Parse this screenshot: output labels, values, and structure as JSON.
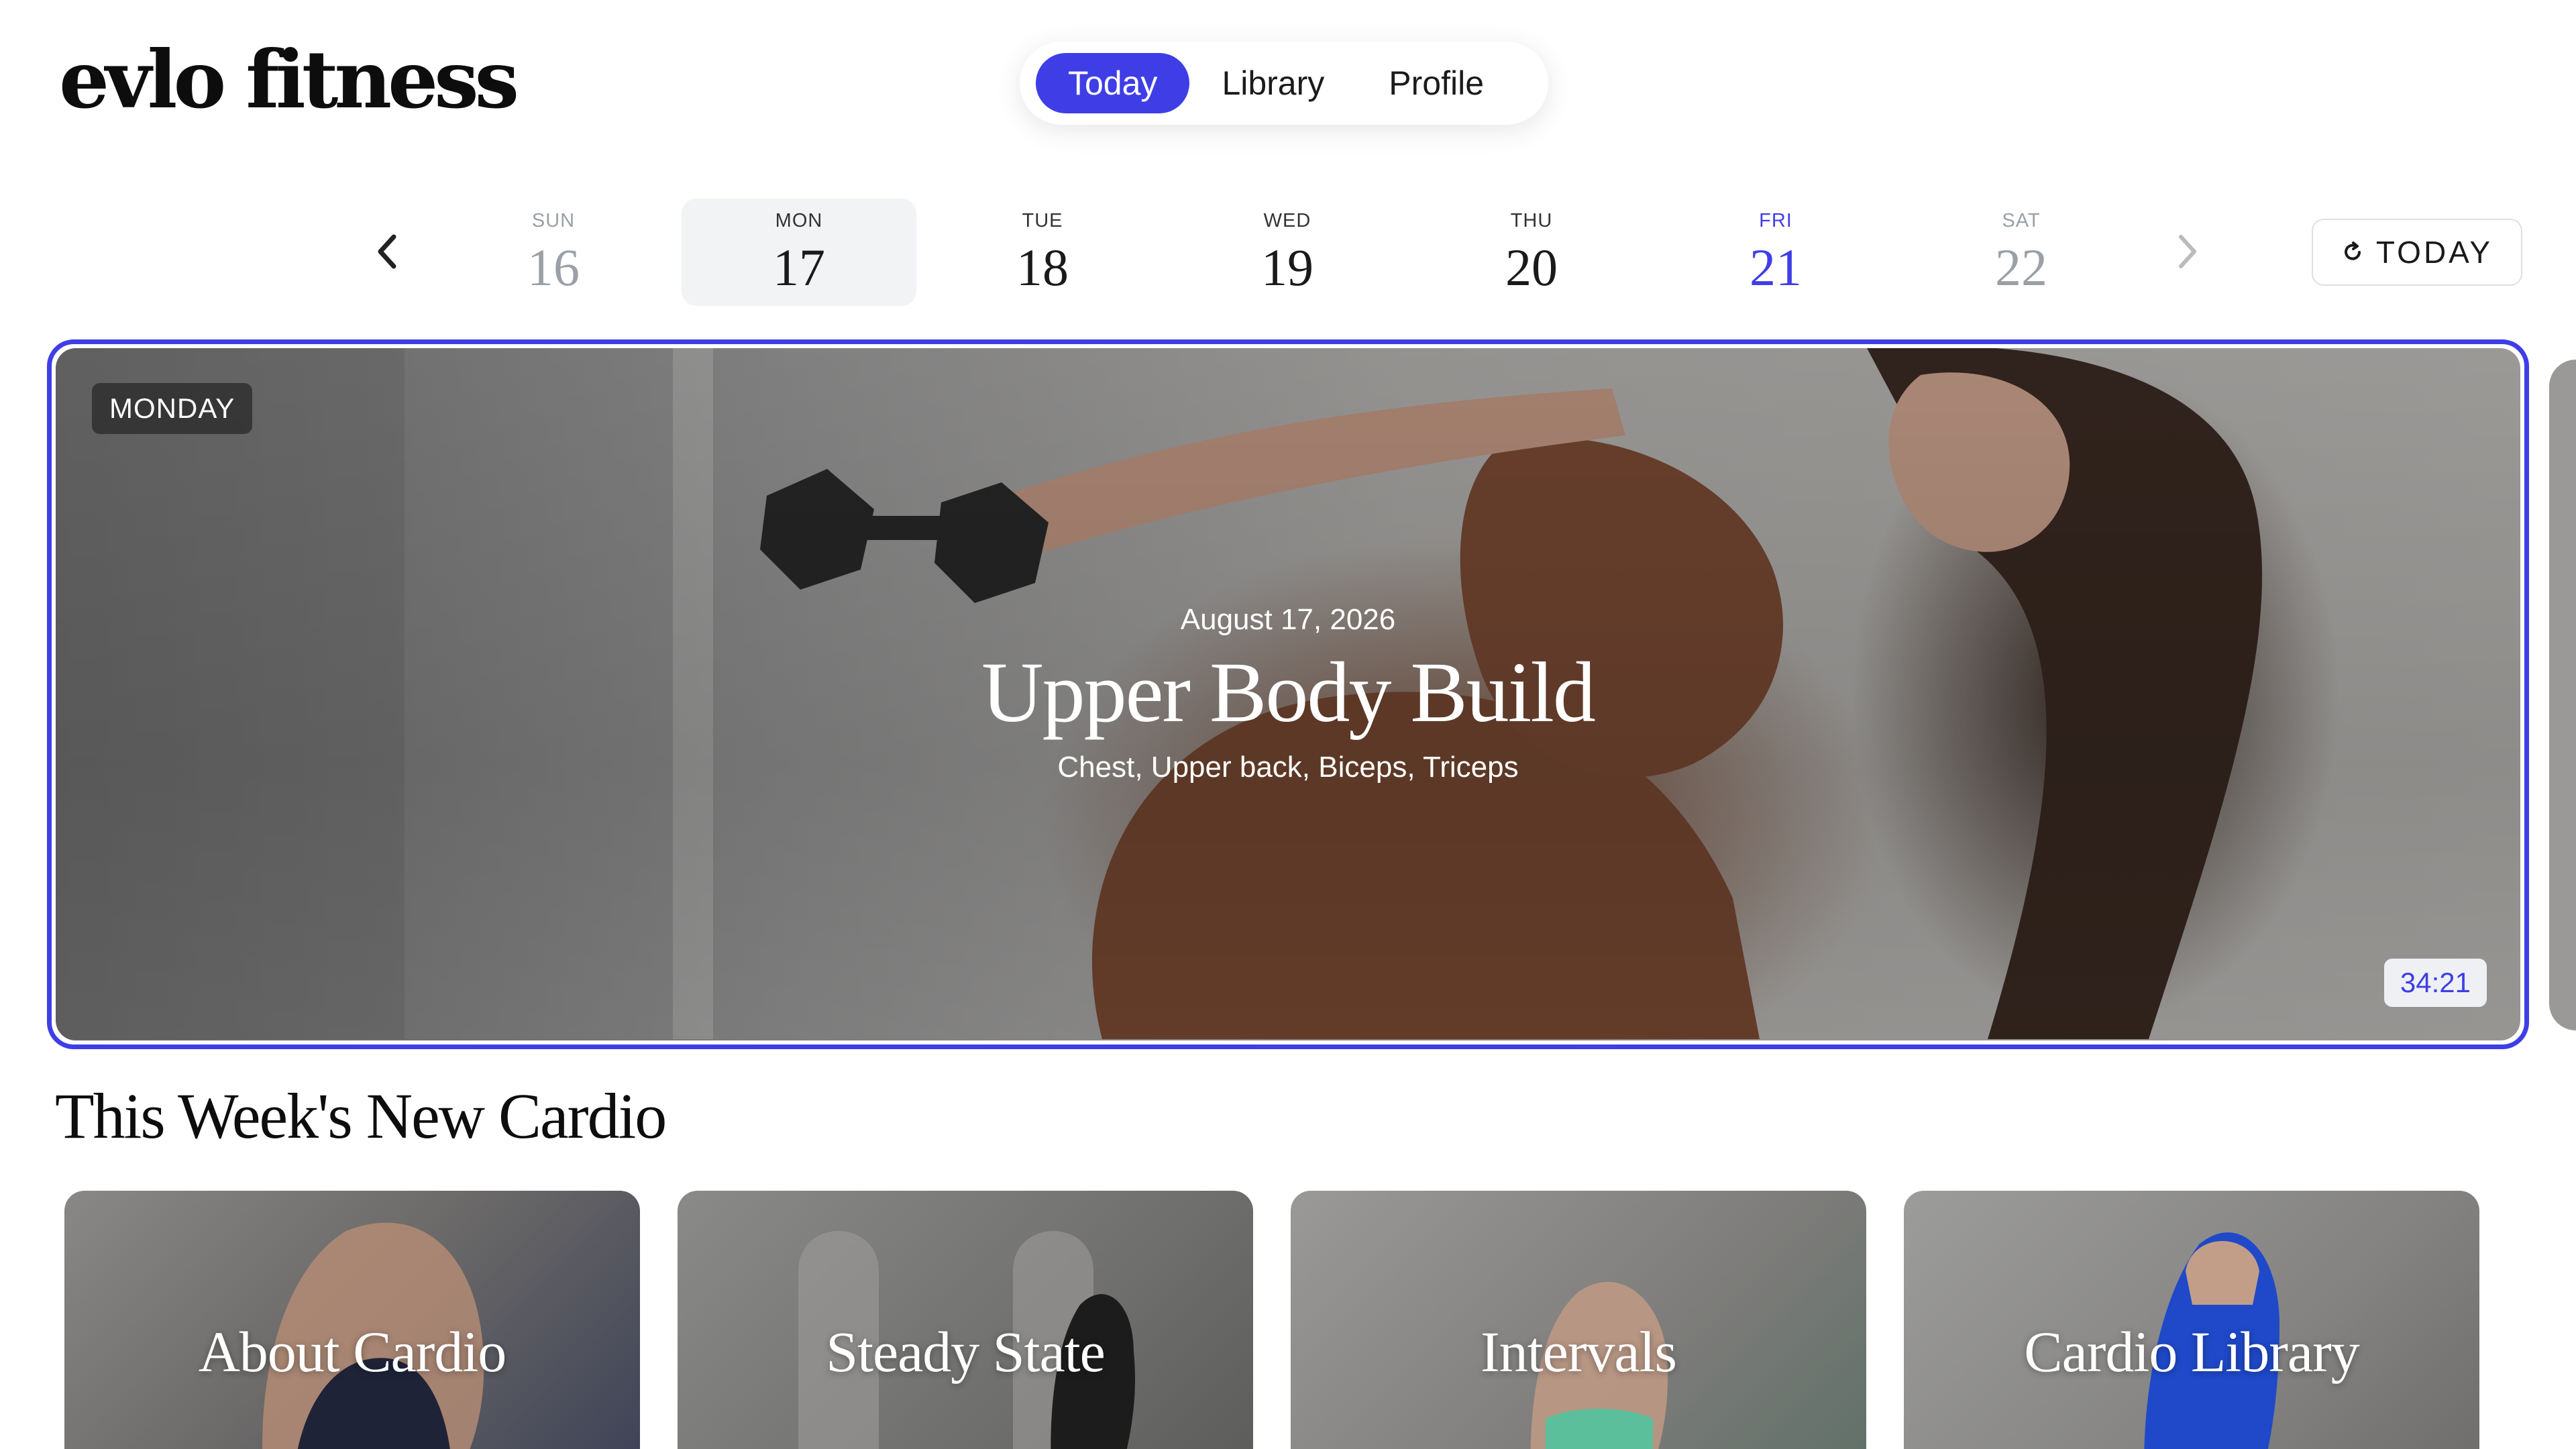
{
  "header": {
    "logo": "evlo fitness",
    "nav": [
      {
        "label": "Today",
        "active": true
      },
      {
        "label": "Library",
        "active": false
      },
      {
        "label": "Profile",
        "active": false
      }
    ]
  },
  "week": {
    "days": [
      {
        "label": "SUN",
        "num": "16",
        "state": "past"
      },
      {
        "label": "MON",
        "num": "17",
        "state": "selected"
      },
      {
        "label": "TUE",
        "num": "18",
        "state": "normal"
      },
      {
        "label": "WED",
        "num": "19",
        "state": "normal"
      },
      {
        "label": "THU",
        "num": "20",
        "state": "normal"
      },
      {
        "label": "FRI",
        "num": "21",
        "state": "accent"
      },
      {
        "label": "SAT",
        "num": "22",
        "state": "future"
      }
    ],
    "today_button": "TODAY"
  },
  "hero": {
    "badge": "MONDAY",
    "date": "August 17, 2026",
    "title": "Upper Body Build",
    "subtitle": "Chest, Upper back, Biceps, Triceps",
    "duration": "34:21"
  },
  "section": {
    "title": "This Week's New Cardio",
    "cards": [
      {
        "label": "About Cardio"
      },
      {
        "label": "Steady State"
      },
      {
        "label": "Intervals"
      },
      {
        "label": "Cardio Library"
      }
    ]
  },
  "colors": {
    "accent": "#3f3ee6",
    "brown": "#7b4a33"
  }
}
